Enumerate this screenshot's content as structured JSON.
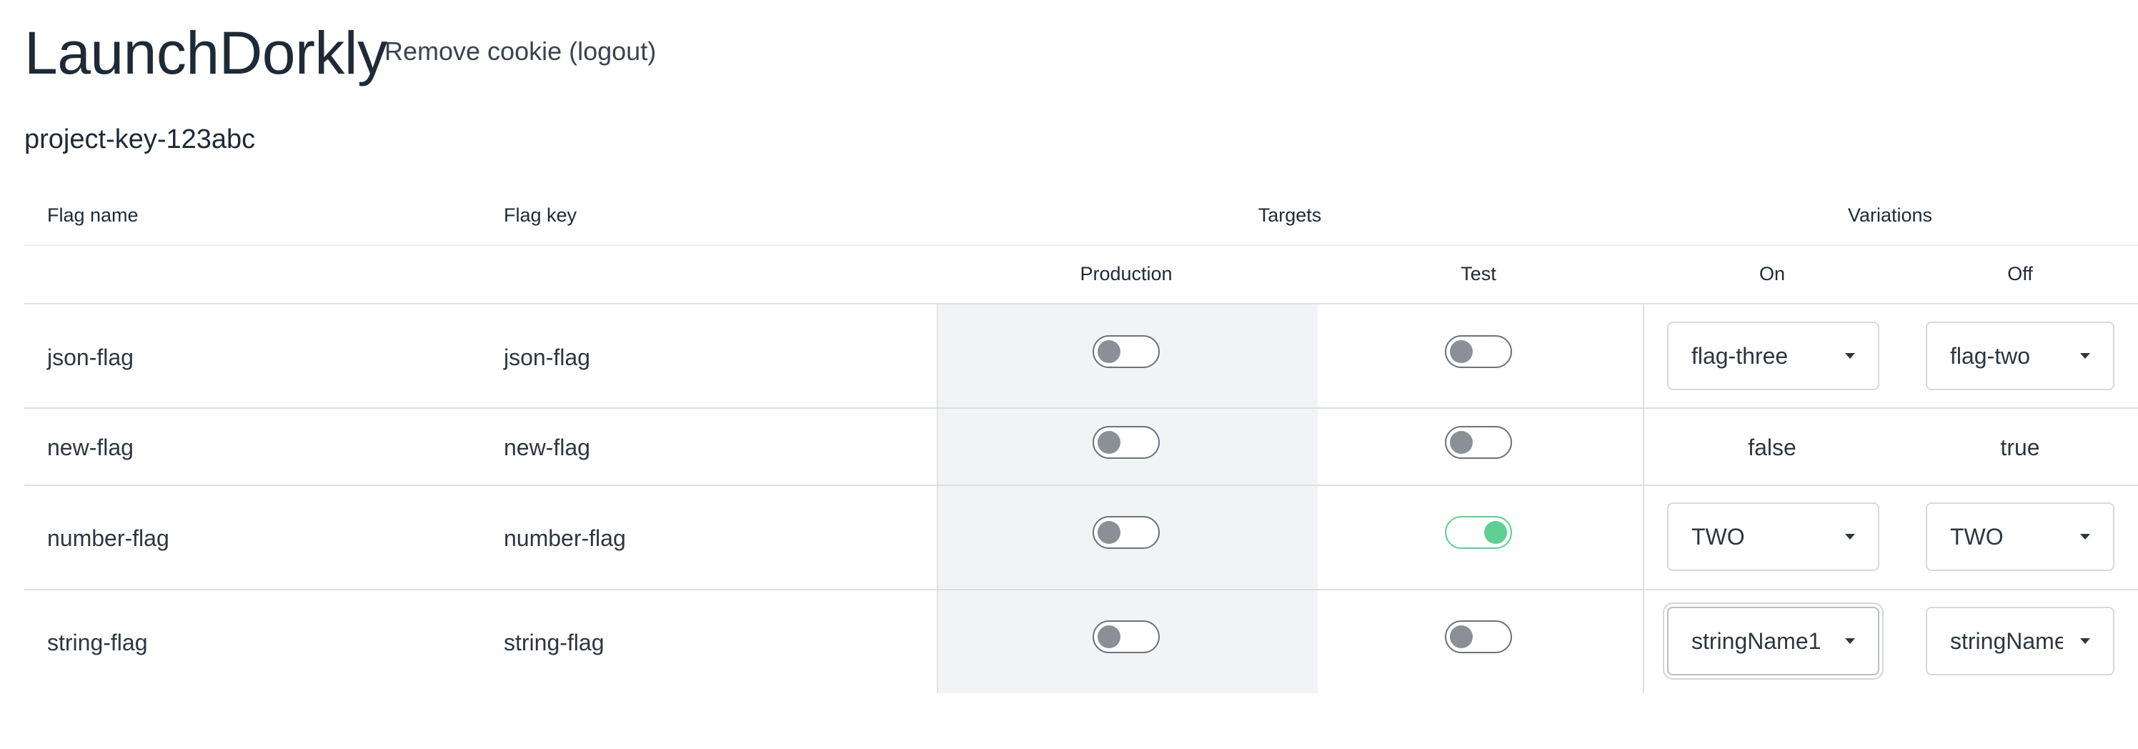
{
  "header": {
    "app_title": "LaunchDorkly",
    "logout_label": "Remove cookie (logout)"
  },
  "project": {
    "key": "project-key-123abc"
  },
  "table": {
    "headers": {
      "flag_name": "Flag name",
      "flag_key": "Flag key",
      "targets": "Targets",
      "variations": "Variations",
      "production": "Production",
      "test": "Test",
      "on": "On",
      "off": "Off"
    },
    "rows": [
      {
        "name": "json-flag",
        "key": "json-flag",
        "production_on": false,
        "test_on": false,
        "on_value": "flag-three",
        "off_value": "flag-two"
      },
      {
        "name": "new-flag",
        "key": "new-flag",
        "production_on": false,
        "test_on": false,
        "on_value": "false",
        "off_value": "true"
      },
      {
        "name": "number-flag",
        "key": "number-flag",
        "production_on": false,
        "test_on": true,
        "on_value": "TWO",
        "off_value": "TWO"
      },
      {
        "name": "string-flag",
        "key": "string-flag",
        "production_on": false,
        "test_on": false,
        "on_value": "stringName1",
        "off_value": "stringName"
      }
    ]
  },
  "colors": {
    "toggle_on": "#5fcf93",
    "toggle_off_knob": "#8b9097",
    "targets_shade": "#f2f3f5"
  }
}
